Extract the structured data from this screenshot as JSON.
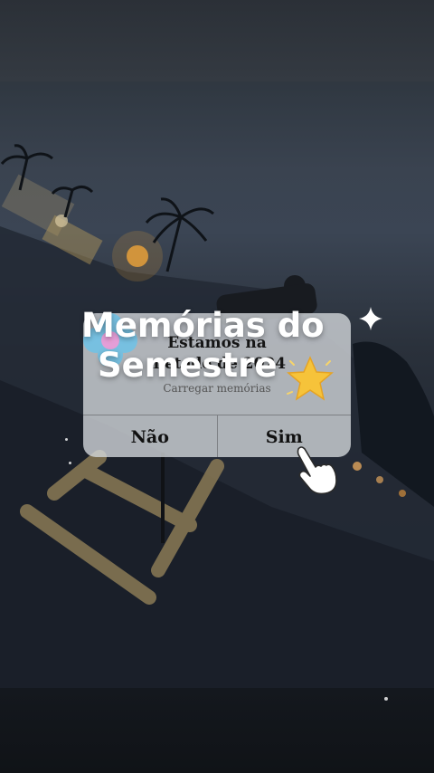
{
  "overlay": {
    "title_line1": "Memórias do",
    "title_line2": "Semestre"
  },
  "dialog": {
    "title_line1": "Estamos na",
    "title_line2": "metade de 2024",
    "subtitle": "Carregar memórias",
    "buttons": {
      "no_label": "Não",
      "yes_label": "Sim"
    }
  },
  "colors": {
    "dialog_bg": "#d6dade",
    "overlay_text": "#ffffff",
    "star": "#f6c33a"
  },
  "icons": [
    "flower-icon",
    "star-icon",
    "sparkle-icon",
    "pointing-hand-icon"
  ]
}
